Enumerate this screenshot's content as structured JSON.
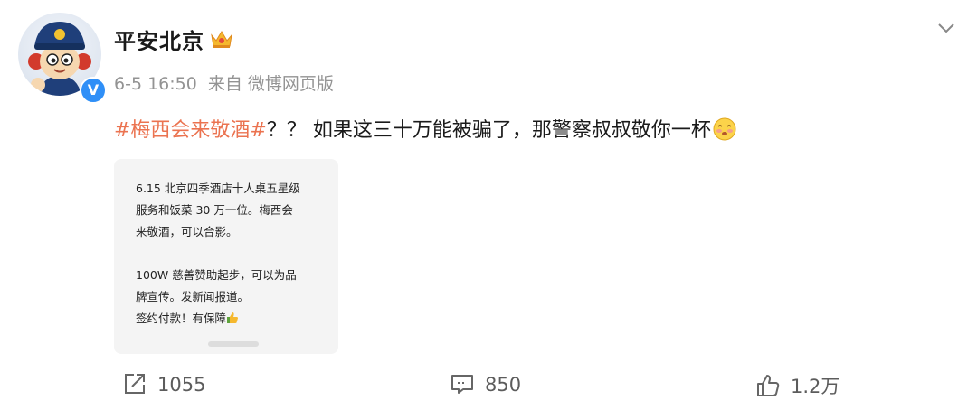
{
  "post": {
    "username": "平安北京",
    "time": "6-5 16:50",
    "source": "来自 微博网页版",
    "hashtag": "#梅西会来敬酒#",
    "text": "？？ 如果这三十万能被骗了，那警察叔叔敬你一杯"
  },
  "card": {
    "lines": [
      "6.15 北京四季酒店十人桌五星级",
      "服务和饭菜 30 万一位。梅西会",
      "来敬酒，可以合影。",
      "100W 慈善赞助起步，可以为品",
      "牌宣传。发新闻报道。",
      "签约付款！有保障"
    ]
  },
  "actions": {
    "repost_count": "1055",
    "comment_count": "850",
    "like_count": "1.2万"
  },
  "colors": {
    "hashtag": "#eb7350",
    "verified_badge": "#2f8ff7"
  },
  "icons": [
    "verified-icon",
    "crown-icon",
    "chevron-down-icon",
    "drunk-emoji-icon",
    "thumbs-up-emoji-icon",
    "repost-icon",
    "comment-icon",
    "like-icon"
  ]
}
